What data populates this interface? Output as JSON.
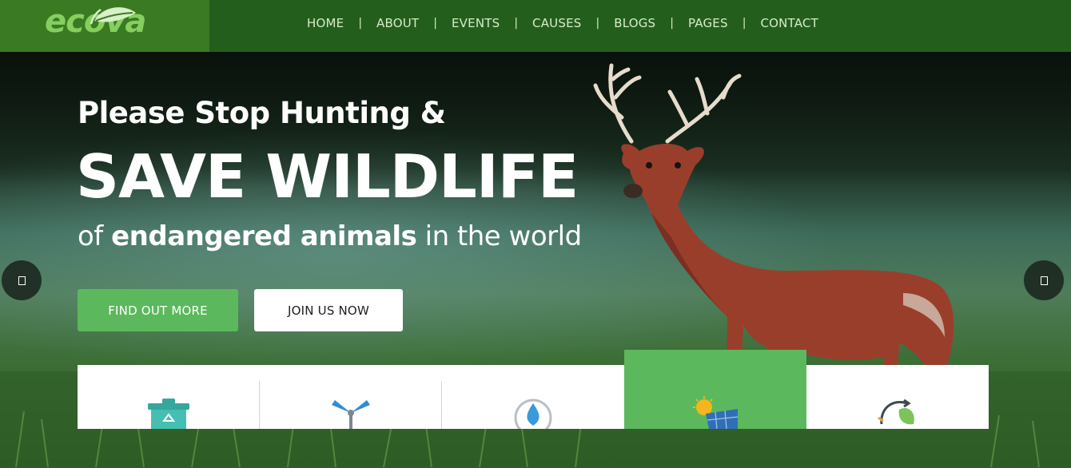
{
  "brand": {
    "logo_text": "ecova"
  },
  "nav": {
    "items": [
      {
        "label": "HOME"
      },
      {
        "label": "ABOUT"
      },
      {
        "label": "EVENTS"
      },
      {
        "label": "CAUSES"
      },
      {
        "label": "BLOGS"
      },
      {
        "label": "PAGES"
      },
      {
        "label": "CONTACT"
      }
    ],
    "separator": "|"
  },
  "hero": {
    "line1_light": "Please ",
    "line1_bold": "Stop Hunting &",
    "line2": "SAVE WILDLIFE",
    "line3_light_a": "of ",
    "line3_bold": "endangered animals",
    "line3_light_b": " in the world",
    "primary_button": "FIND OUT MORE",
    "secondary_button": "JOIN US NOW",
    "prev_icon": "chevron-left-icon",
    "next_icon": "chevron-right-icon"
  },
  "features": {
    "items": [
      {
        "icon": "recycle-bin-icon"
      },
      {
        "icon": "wind-turbine-icon"
      },
      {
        "icon": "water-drop-icon"
      },
      {
        "icon": "solar-panel-icon",
        "active": true
      },
      {
        "icon": "recycle-leaf-icon"
      }
    ]
  },
  "colors": {
    "header": "#245e1c",
    "logo_bg": "#3a7a22",
    "accent": "#5cb85c",
    "nav_text": "#d6ecc9"
  }
}
